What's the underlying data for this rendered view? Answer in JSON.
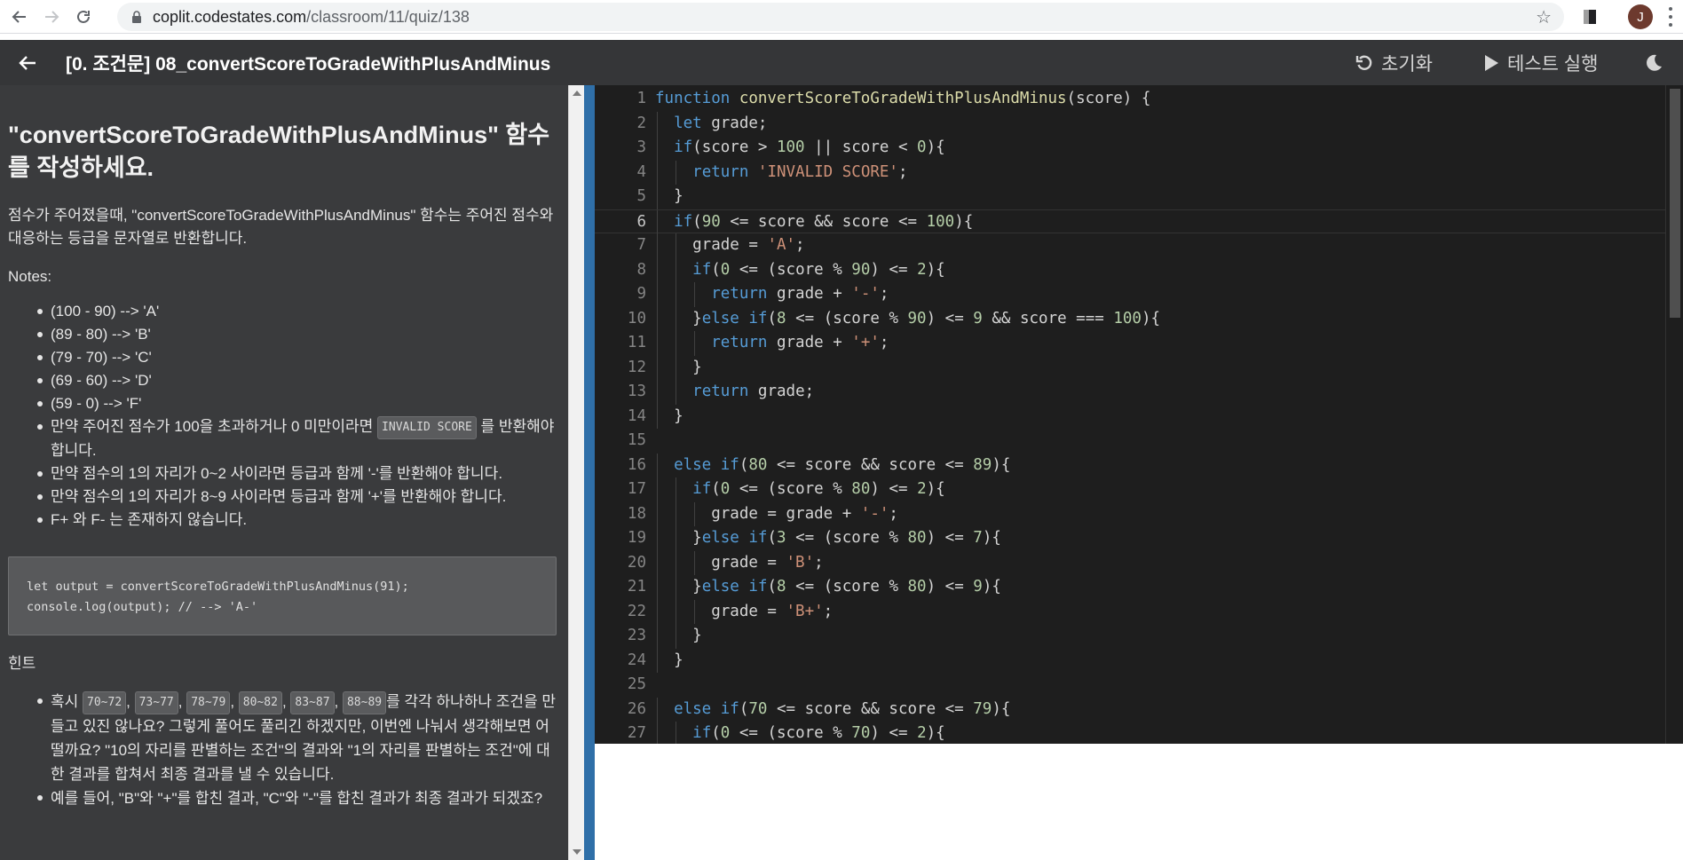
{
  "browser": {
    "url_host": "coplit.codestates.com",
    "url_path": "/classroom/11/quiz/138",
    "avatar_letter": "J"
  },
  "header": {
    "title": "[0. 조건문] 08_convertScoreToGradeWithPlusAndMinus",
    "reset_label": "초기화",
    "run_label": "테스트 실행"
  },
  "problem": {
    "heading": "\"convertScoreToGradeWithPlusAndMinus\" 함수를 작성하세요.",
    "description": "점수가 주어졌을때, \"convertScoreToGradeWithPlusAndMinus\" 함수는 주어진 점수와 대응하는 등급을 문자열로 반환합니다.",
    "notes_label": "Notes:",
    "notes": [
      "(100 - 90) --> 'A'",
      "(89 - 80) --> 'B'",
      "(79 - 70) --> 'C'",
      "(69 - 60) --> 'D'",
      "(59 - 0) --> 'F'"
    ],
    "note_invalid_pre": "만약 주어진 점수가 100을 초과하거나 0 미만이라면 ",
    "note_invalid_code": "INVALID SCORE",
    "note_invalid_post": " 를 반환해야 합니다.",
    "note_minus": "만약 점수의 1의 자리가 0~2 사이라면 등급과 함께 '-'를 반환해야 합니다.",
    "note_plus": "만약 점수의 1의 자리가 8~9 사이라면 등급과 함께 '+'를 반환해야 합니다.",
    "note_fplus": "F+ 와 F- 는 존재하지 않습니다.",
    "example_code": "let output = convertScoreToGradeWithPlusAndMinus(91);\nconsole.log(output); // --> 'A-'",
    "hint_label": "힌트",
    "hint_pre": "혹시 ",
    "hint_codes": [
      "70~72",
      "73~77",
      "78~79",
      "80~82",
      "83~87",
      "88~89"
    ],
    "hint_post": "를 각각 하나하나 조건을 만들고 있진 않나요? 그렇게 풀어도 풀리긴 하겠지만, 이번엔 나눠서 생각해보면 어떨까요? \"10의 자리를 판별하는 조건\"의 결과와 \"1의 자리를 판별하는 조건\"에 대한 결과를 합쳐서 최종 결과를 낼 수 있습니다.",
    "hint_2": "예를 들어, \"B\"와 \"+\"를 합친 결과, \"C\"와 \"-\"를 합친 결과가 최종 결과가 되겠죠?"
  },
  "editor": {
    "active_line": 6,
    "lines": [
      [
        [
          "k",
          "function "
        ],
        [
          "f",
          "convertScoreToGradeWithPlusAndMinus"
        ],
        [
          "v",
          "(score) {"
        ]
      ],
      [
        [
          "v",
          "  "
        ],
        [
          "k",
          "let "
        ],
        [
          "v",
          "grade;"
        ]
      ],
      [
        [
          "v",
          "  "
        ],
        [
          "k",
          "if"
        ],
        [
          "v",
          "(score > "
        ],
        [
          "n",
          "100"
        ],
        [
          "v",
          " || score < "
        ],
        [
          "n",
          "0"
        ],
        [
          "v",
          "){"
        ]
      ],
      [
        [
          "v",
          "    "
        ],
        [
          "k",
          "return "
        ],
        [
          "s",
          "'INVALID SCORE'"
        ],
        [
          "v",
          ";"
        ]
      ],
      [
        [
          "v",
          "  }"
        ]
      ],
      [
        [
          "v",
          "  "
        ],
        [
          "k",
          "if"
        ],
        [
          "v",
          "("
        ],
        [
          "n",
          "90"
        ],
        [
          "v",
          " <= score && score <= "
        ],
        [
          "n",
          "100"
        ],
        [
          "v",
          "){"
        ]
      ],
      [
        [
          "v",
          "    grade = "
        ],
        [
          "s",
          "'A'"
        ],
        [
          "v",
          ";"
        ]
      ],
      [
        [
          "v",
          "    "
        ],
        [
          "k",
          "if"
        ],
        [
          "v",
          "("
        ],
        [
          "n",
          "0"
        ],
        [
          "v",
          " <= (score % "
        ],
        [
          "n",
          "90"
        ],
        [
          "v",
          ") <= "
        ],
        [
          "n",
          "2"
        ],
        [
          "v",
          "){"
        ]
      ],
      [
        [
          "v",
          "      "
        ],
        [
          "k",
          "return "
        ],
        [
          "v",
          "grade + "
        ],
        [
          "s",
          "'-'"
        ],
        [
          "v",
          ";"
        ]
      ],
      [
        [
          "v",
          "    }"
        ],
        [
          "k",
          "else if"
        ],
        [
          "v",
          "("
        ],
        [
          "n",
          "8"
        ],
        [
          "v",
          " <= (score % "
        ],
        [
          "n",
          "90"
        ],
        [
          "v",
          ") <= "
        ],
        [
          "n",
          "9"
        ],
        [
          "v",
          " && score === "
        ],
        [
          "n",
          "100"
        ],
        [
          "v",
          "){"
        ]
      ],
      [
        [
          "v",
          "      "
        ],
        [
          "k",
          "return "
        ],
        [
          "v",
          "grade + "
        ],
        [
          "s",
          "'+'"
        ],
        [
          "v",
          ";"
        ]
      ],
      [
        [
          "v",
          "    }"
        ]
      ],
      [
        [
          "v",
          "    "
        ],
        [
          "k",
          "return "
        ],
        [
          "v",
          "grade;"
        ]
      ],
      [
        [
          "v",
          "  }"
        ]
      ],
      [
        [
          "v",
          ""
        ]
      ],
      [
        [
          "v",
          "  "
        ],
        [
          "k",
          "else if"
        ],
        [
          "v",
          "("
        ],
        [
          "n",
          "80"
        ],
        [
          "v",
          " <= score && score <= "
        ],
        [
          "n",
          "89"
        ],
        [
          "v",
          "){"
        ]
      ],
      [
        [
          "v",
          "    "
        ],
        [
          "k",
          "if"
        ],
        [
          "v",
          "("
        ],
        [
          "n",
          "0"
        ],
        [
          "v",
          " <= (score % "
        ],
        [
          "n",
          "80"
        ],
        [
          "v",
          ") <= "
        ],
        [
          "n",
          "2"
        ],
        [
          "v",
          "){"
        ]
      ],
      [
        [
          "v",
          "      grade = grade + "
        ],
        [
          "s",
          "'-'"
        ],
        [
          "v",
          ";"
        ]
      ],
      [
        [
          "v",
          "    }"
        ],
        [
          "k",
          "else if"
        ],
        [
          "v",
          "("
        ],
        [
          "n",
          "3"
        ],
        [
          "v",
          " <= (score % "
        ],
        [
          "n",
          "80"
        ],
        [
          "v",
          ") <= "
        ],
        [
          "n",
          "7"
        ],
        [
          "v",
          "){"
        ]
      ],
      [
        [
          "v",
          "      grade = "
        ],
        [
          "s",
          "'B'"
        ],
        [
          "v",
          ";"
        ]
      ],
      [
        [
          "v",
          "    }"
        ],
        [
          "k",
          "else if"
        ],
        [
          "v",
          "("
        ],
        [
          "n",
          "8"
        ],
        [
          "v",
          " <= (score % "
        ],
        [
          "n",
          "80"
        ],
        [
          "v",
          ") <= "
        ],
        [
          "n",
          "9"
        ],
        [
          "v",
          "){"
        ]
      ],
      [
        [
          "v",
          "      grade = "
        ],
        [
          "s",
          "'B+'"
        ],
        [
          "v",
          ";"
        ]
      ],
      [
        [
          "v",
          "    }"
        ]
      ],
      [
        [
          "v",
          "  }"
        ]
      ],
      [
        [
          "v",
          ""
        ]
      ],
      [
        [
          "v",
          "  "
        ],
        [
          "k",
          "else if"
        ],
        [
          "v",
          "("
        ],
        [
          "n",
          "70"
        ],
        [
          "v",
          " <= score && score <= "
        ],
        [
          "n",
          "79"
        ],
        [
          "v",
          "){"
        ]
      ],
      [
        [
          "v",
          "    "
        ],
        [
          "k",
          "if"
        ],
        [
          "v",
          "("
        ],
        [
          "n",
          "0"
        ],
        [
          "v",
          " <= (score % "
        ],
        [
          "n",
          "70"
        ],
        [
          "v",
          ") <= "
        ],
        [
          "n",
          "2"
        ],
        [
          "v",
          "){"
        ]
      ]
    ]
  },
  "colors": {
    "header_bg": "#353638",
    "panel_bg": "#3a3b3d",
    "editor_bg": "#1e1e1e",
    "divider": "#2f6fa8",
    "keyword": "#569cd6",
    "function": "#dcdcaa",
    "number": "#b5cea8",
    "string": "#ce9178"
  }
}
